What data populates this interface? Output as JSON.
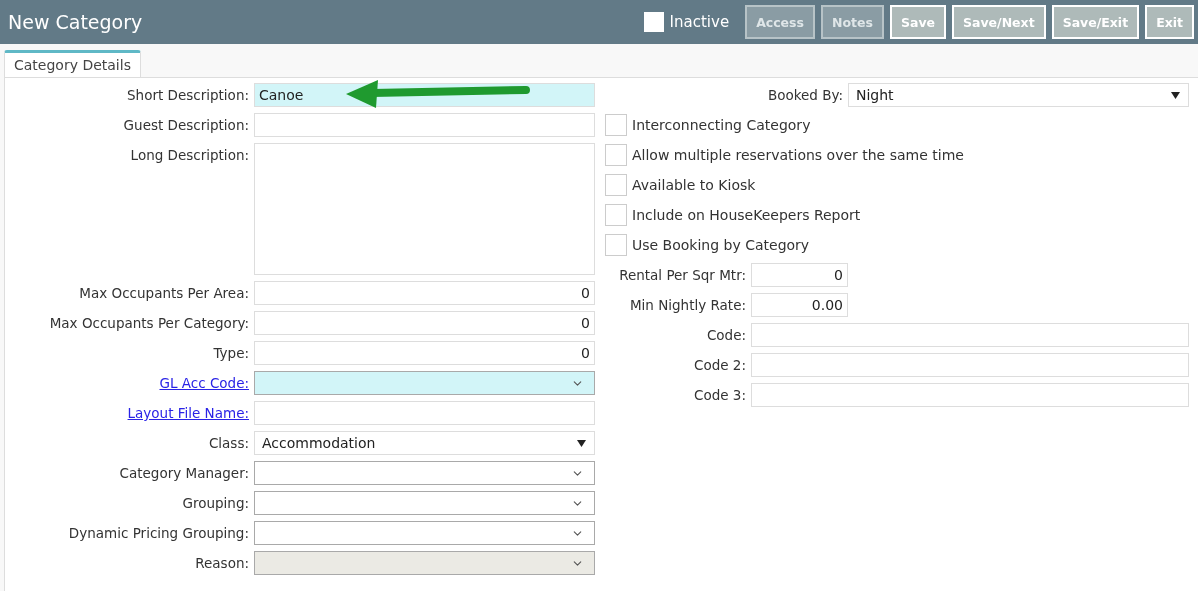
{
  "header": {
    "title": "New Category",
    "inactive": {
      "label": "Inactive",
      "checked": false
    },
    "buttons": [
      {
        "label": "Access",
        "disabled": true
      },
      {
        "label": "Notes",
        "disabled": true
      },
      {
        "label": "Save",
        "disabled": false
      },
      {
        "label": "Save/Next",
        "disabled": false
      },
      {
        "label": "Save/Exit",
        "disabled": false
      },
      {
        "label": "Exit",
        "disabled": false
      }
    ]
  },
  "tabs": [
    {
      "label": "Category Details",
      "selected": true
    }
  ],
  "left_fields": [
    {
      "label": "Short Description:",
      "kind": "text",
      "link": false,
      "highlighted": true,
      "disabled": false,
      "value": "Canoe"
    },
    {
      "label": "Guest Description:",
      "kind": "text",
      "link": false,
      "highlighted": false,
      "disabled": false
    },
    {
      "label": "Long Description:",
      "kind": "textarea",
      "link": false,
      "highlighted": false,
      "disabled": false
    },
    {
      "label": "Max Occupants Per Area:",
      "kind": "number",
      "link": false,
      "highlighted": false,
      "disabled": false,
      "value": "0"
    },
    {
      "label": "Max Occupants Per Category:",
      "kind": "number",
      "link": false,
      "highlighted": false,
      "disabled": false,
      "value": "0"
    },
    {
      "label": "Type:",
      "kind": "number",
      "link": false,
      "highlighted": false,
      "disabled": false,
      "value": "0"
    },
    {
      "label": "GL Acc Code:",
      "kind": "dropdown",
      "link": true,
      "highlighted": true,
      "disabled": false
    },
    {
      "label": "Layout File Name:",
      "kind": "text",
      "link": true,
      "highlighted": false,
      "disabled": false
    },
    {
      "label": "Class:",
      "kind": "select",
      "link": false,
      "highlighted": false,
      "disabled": false,
      "value": "Accommodation"
    },
    {
      "label": "Category Manager:",
      "kind": "dropdown",
      "link": false,
      "highlighted": false,
      "disabled": false
    },
    {
      "label": "Grouping:",
      "kind": "dropdown",
      "link": false,
      "highlighted": false,
      "disabled": false
    },
    {
      "label": "Dynamic Pricing Grouping:",
      "kind": "dropdown",
      "link": false,
      "highlighted": false,
      "disabled": false
    },
    {
      "label": "Reason:",
      "kind": "dropdown",
      "link": false,
      "highlighted": false,
      "disabled": true
    }
  ],
  "booked_by": {
    "label": "Booked By:",
    "value": "Night"
  },
  "options": [
    {
      "label": "Interconnecting Category",
      "checked": false
    },
    {
      "label": "Allow multiple reservations over the same time",
      "checked": false
    },
    {
      "label": "Available to Kiosk",
      "checked": false
    },
    {
      "label": "Include on HouseKeepers Report",
      "checked": false
    },
    {
      "label": "Use Booking by Category",
      "checked": false
    }
  ],
  "right_fields": [
    {
      "label": "Rental Per Sqr Mtr:",
      "kind": "number",
      "value": "0"
    },
    {
      "label": "Min Nightly Rate:",
      "kind": "number",
      "value": "0.00"
    },
    {
      "label": "Code:",
      "kind": "text"
    },
    {
      "label": "Code 2:",
      "kind": "text"
    },
    {
      "label": "Code 3:",
      "kind": "text"
    }
  ]
}
